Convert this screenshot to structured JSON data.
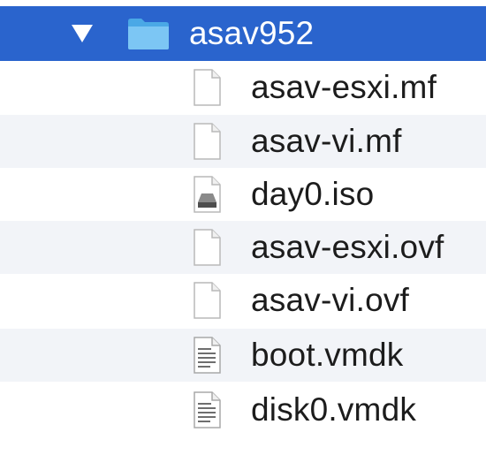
{
  "folder": {
    "name": "asav952",
    "expanded": true,
    "selected": true
  },
  "files": [
    {
      "name": "asav-esxi.mf",
      "icon": "blank-document-icon"
    },
    {
      "name": "asav-vi.mf",
      "icon": "blank-document-icon"
    },
    {
      "name": "day0.iso",
      "icon": "disk-image-icon"
    },
    {
      "name": "asav-esxi.ovf",
      "icon": "blank-document-icon"
    },
    {
      "name": "asav-vi.ovf",
      "icon": "blank-document-icon"
    },
    {
      "name": "boot.vmdk",
      "icon": "text-document-icon"
    },
    {
      "name": "disk0.vmdk",
      "icon": "text-document-icon"
    }
  ],
  "colors": {
    "selection": "#2a64cd",
    "folder": "#5cb6ee",
    "alt_row": "#f2f4f8",
    "text": "#1c1c1c"
  }
}
